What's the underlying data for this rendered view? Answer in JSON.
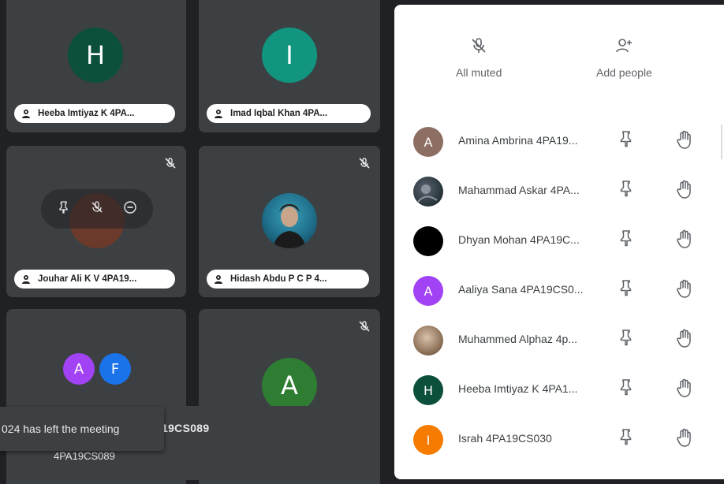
{
  "tiles": [
    {
      "initial": "H",
      "color": "#0b4f3c",
      "name": "Heeba Imtiyaz K 4PA..."
    },
    {
      "initial": "I",
      "color": "#11957f",
      "name": "Imad Iqbal Khan 4PA..."
    },
    {
      "initial": "",
      "color": "#6b3a2a",
      "name": "Jouhar Ali K V 4PA19..."
    },
    {
      "initial": "",
      "color": "#1f6f8b",
      "name": "Hidash Abdu P C P 4..."
    },
    {
      "initials": [
        "A",
        "F"
      ],
      "colors": [
        "#a142f4",
        "#1a73e8"
      ]
    },
    {
      "initial": "A",
      "color": "#2e7d32"
    }
  ],
  "toast": {
    "text": "024 has left the meeting"
  },
  "presenting": {
    "name_fragment": "19CS089",
    "subtitle": "4PA19CS089"
  },
  "panel": {
    "all_muted_label": "All muted",
    "add_people_label": "Add people"
  },
  "people": [
    {
      "name": "Amina Ambrina 4PA19...",
      "initial": "A",
      "color": "#8d6e63"
    },
    {
      "name": "Mahammad Askar 4PA...",
      "initial": "",
      "color": "#263238"
    },
    {
      "name": "Dhyan Mohan 4PA19C...",
      "initial": "",
      "color": "#000000"
    },
    {
      "name": "Aaliya Sana 4PA19CS0...",
      "initial": "A",
      "color": "#a142f4"
    },
    {
      "name": "Muhammed Alphaz 4p...",
      "initial": "",
      "color": "#8a6e55"
    },
    {
      "name": "Heeba Imtiyaz K 4PA1...",
      "initial": "H",
      "color": "#0b4f3c"
    },
    {
      "name": "Israh 4PA19CS030",
      "initial": "I",
      "color": "#f57c00"
    }
  ]
}
